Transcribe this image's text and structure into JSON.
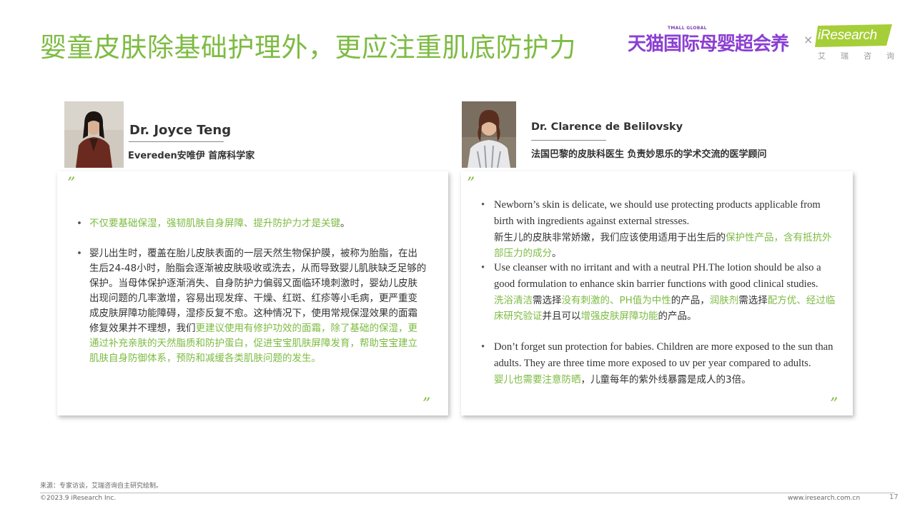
{
  "page": {
    "title": "婴童皮肤除基础护理外，更应注重肌底防护力",
    "number": "17"
  },
  "logo": {
    "tmall_small": "TMALL GLOBAL",
    "tmall": "天猫国际母婴超会养",
    "times": "×",
    "iresearch": "iResearch",
    "iresearch_cn": "艾瑞咨询",
    "accent": "#a6ce39"
  },
  "experts": [
    {
      "name": "Dr. Joyce Teng",
      "role": "Evereden安唯伊 首席科学家",
      "bullets": [
        {
          "segments": [
            {
              "text": "不仅要基础保湿，强韧肌肤自身屏障、提升防护力才是关键",
              "highlight": true
            },
            {
              "text": "。",
              "highlight": false
            }
          ]
        },
        {
          "segments": [
            {
              "text": "婴儿出生时，覆盖在胎儿皮肤表面的一层天然生物保护膜，被称为胎脂，在出生后24-48小时，胎脂会逐渐被皮肤吸收或洗去，从而导致婴儿肌肤缺乏足够的保护。当母体保护逐渐消失、自身防护力偏弱又面临环境刺激时，婴幼儿皮肤出现问题的几率激增，容易出现发痒、干燥、红斑、红疹等小毛病，更严重变成皮肤屏障功能障碍，湿疹反复不愈。这种情况下，使用常规保湿效果的面霜修复效果并不理想，我们",
              "highlight": false
            },
            {
              "text": "更建议使用有修护功效的面霜，除了基础的保湿，更通过补充亲肤的天然脂质和防护蛋白，促进宝宝肌肤屏障发育，帮助宝宝建立肌肤自身防御体系，预防和减缓各类肌肤问题的发生。",
              "highlight": true
            }
          ]
        }
      ]
    },
    {
      "name": "Dr. Clarence de Belilovsky",
      "role": "法国巴黎的皮肤科医生 负责妙思乐的学术交流的医学顾问",
      "bullets": [
        {
          "en": "Newborn’s skin is delicate, we should use protecting products applicable from birth with ingredients against external stresses.",
          "segments": [
            {
              "text": "新生儿的皮肤非常娇嫩，我们应该使用适用于出生后的",
              "highlight": false
            },
            {
              "text": "保护性产品，含有抵抗外部压力的成分",
              "highlight": true
            },
            {
              "text": "。",
              "highlight": false
            }
          ]
        },
        {
          "en": "Use cleanser with no irritant and with a neutral PH.The lotion should be also a good formulation to enhance skin barrier functions with good clinical studies.",
          "segments": [
            {
              "text": "洗浴清洁",
              "highlight": true
            },
            {
              "text": "需选择",
              "highlight": false
            },
            {
              "text": "没有刺激的、PH值为中性",
              "highlight": true
            },
            {
              "text": "的产品，",
              "highlight": false
            },
            {
              "text": "润肤剂",
              "highlight": true
            },
            {
              "text": "需选择",
              "highlight": false
            },
            {
              "text": "配方优、经过临床研究验证",
              "highlight": true
            },
            {
              "text": "并且可以",
              "highlight": false
            },
            {
              "text": "增强皮肤屏障功能",
              "highlight": true
            },
            {
              "text": "的产品。",
              "highlight": false
            }
          ]
        },
        {
          "en": "Don’t forget sun protection for babies. Children are more exposed to the sun than adults. They are three time more exposed to uv per year compared to adults.",
          "segments": [
            {
              "text": "婴儿也需要注意防晒",
              "highlight": true
            },
            {
              "text": "，儿童每年的紫外线暴露是成人的3倍。",
              "highlight": false
            }
          ]
        }
      ]
    }
  ],
  "quote_open": "”",
  "quote_close": "”",
  "bullet_glyph": "•",
  "footer": {
    "source": "来源：专家访谈，艾瑞咨询自主研究绘制。",
    "copyright": "©2023.9 iResearch Inc.",
    "website": "www.iresearch.com.cn"
  },
  "colors": {
    "title_green": "#7dbb42",
    "highlight_green": "#7dbb42",
    "tmall_purple": "#8b3fd1"
  }
}
